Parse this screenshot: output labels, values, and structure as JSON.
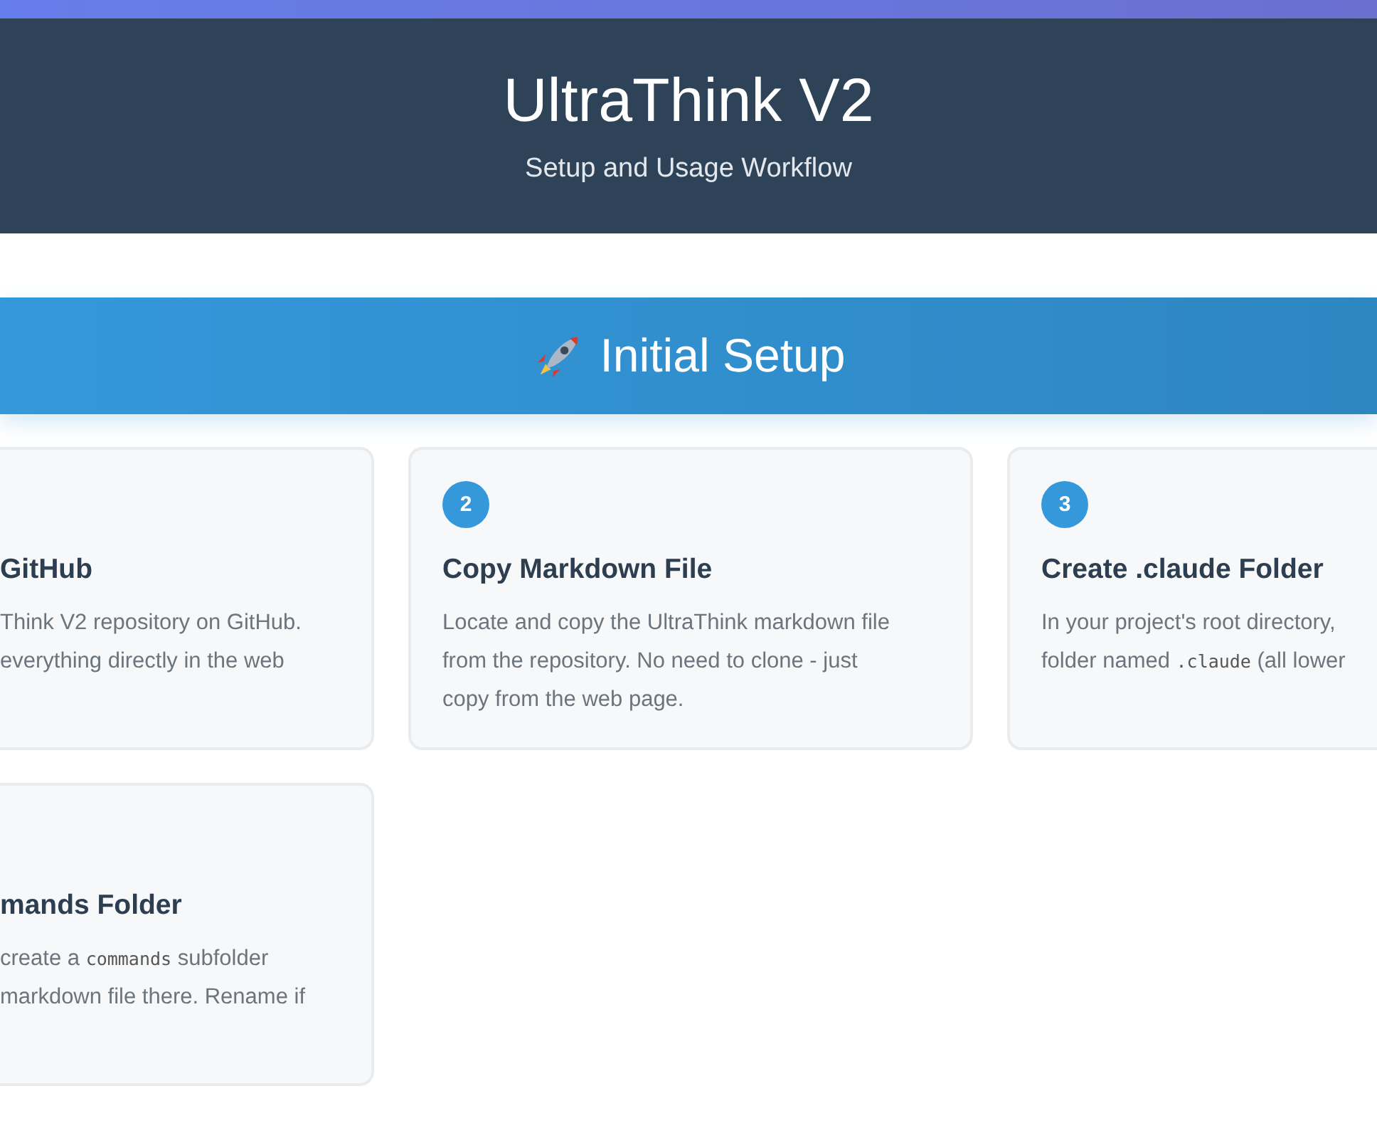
{
  "header": {
    "title": "UltraThink V2",
    "subtitle": "Setup and Usage Workflow"
  },
  "section": {
    "title": "Initial Setup"
  },
  "cards": [
    {
      "clipped_left": true,
      "title": "GitHub",
      "lines": [
        [
          {
            "kind": "text",
            "text": "Think V2 repository on GitHub."
          }
        ],
        [
          {
            "kind": "text",
            "text": "everything directly in the web"
          }
        ]
      ]
    },
    {
      "clipped_left": false,
      "number": "2",
      "title": "Copy Markdown File",
      "lines": [
        [
          {
            "kind": "text",
            "text": "Locate and copy the UltraThink markdown file"
          }
        ],
        [
          {
            "kind": "text",
            "text": "from the repository. No need to clone - just"
          }
        ],
        [
          {
            "kind": "text",
            "text": "copy from the web page."
          }
        ]
      ]
    },
    {
      "clipped_left": false,
      "number": "3",
      "title": "Create .claude Folder",
      "lines": [
        [
          {
            "kind": "text",
            "text": "In your project's root directory,"
          }
        ],
        [
          {
            "kind": "text",
            "text": "folder named "
          },
          {
            "kind": "code",
            "text": ".claude"
          },
          {
            "kind": "text",
            "text": " (all lower"
          }
        ]
      ]
    },
    {
      "clipped_left": true,
      "title": "mands Folder",
      "lines": [
        [
          {
            "kind": "text",
            "text": "create a "
          },
          {
            "kind": "code",
            "text": "commands"
          },
          {
            "kind": "text",
            "text": " subfolder"
          }
        ],
        [
          {
            "kind": "text",
            "text": "markdown file there. Rename if"
          }
        ]
      ]
    }
  ]
}
